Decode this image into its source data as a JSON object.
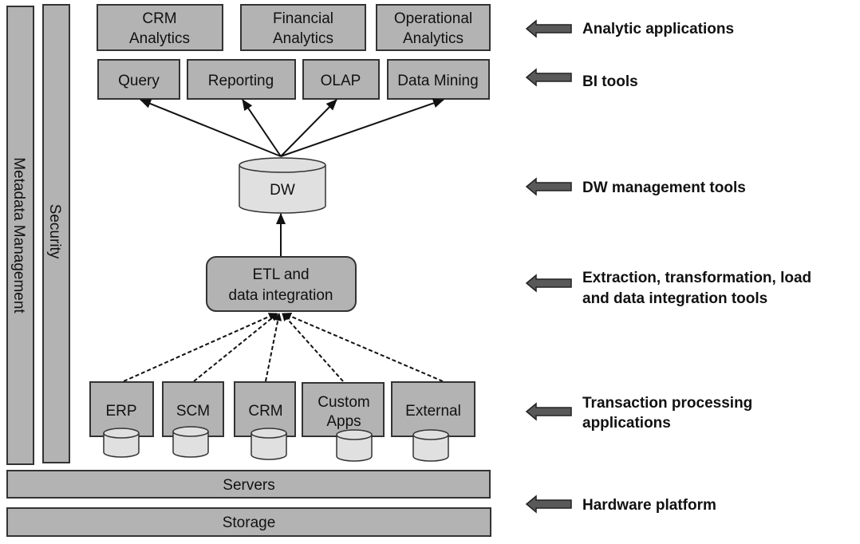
{
  "colors": {
    "box_fill": "#b3b3b3",
    "cylinder_fill": "#e0e0e0",
    "stroke": "#333333",
    "layer_arrow": "#595959"
  },
  "side_bars": {
    "metadata": "Metadata Management",
    "security": "Security"
  },
  "analytic_apps": [
    {
      "line1": "CRM",
      "line2": "Analytics"
    },
    {
      "line1": "Financial",
      "line2": "Analytics"
    },
    {
      "line1": "Operational",
      "line2": "Analytics"
    }
  ],
  "bi_tools": [
    "Query",
    "Reporting",
    "OLAP",
    "Data Mining"
  ],
  "dw": "DW",
  "etl": {
    "line1": "ETL and",
    "line2": "data integration"
  },
  "sources": [
    {
      "line1": "ERP",
      "line2": ""
    },
    {
      "line1": "SCM",
      "line2": ""
    },
    {
      "line1": "CRM",
      "line2": ""
    },
    {
      "line1": "Custom",
      "line2": "Apps"
    },
    {
      "line1": "External",
      "line2": ""
    }
  ],
  "platform": {
    "servers": "Servers",
    "storage": "Storage"
  },
  "layers": [
    {
      "line1": "Analytic applications",
      "line2": ""
    },
    {
      "line1": "BI tools",
      "line2": ""
    },
    {
      "line1": "DW management tools",
      "line2": ""
    },
    {
      "line1": "Extraction, transformation, load",
      "line2": "and data integration tools"
    },
    {
      "line1": "Transaction processing",
      "line2": "applications"
    },
    {
      "line1": "Hardware platform",
      "line2": ""
    }
  ]
}
